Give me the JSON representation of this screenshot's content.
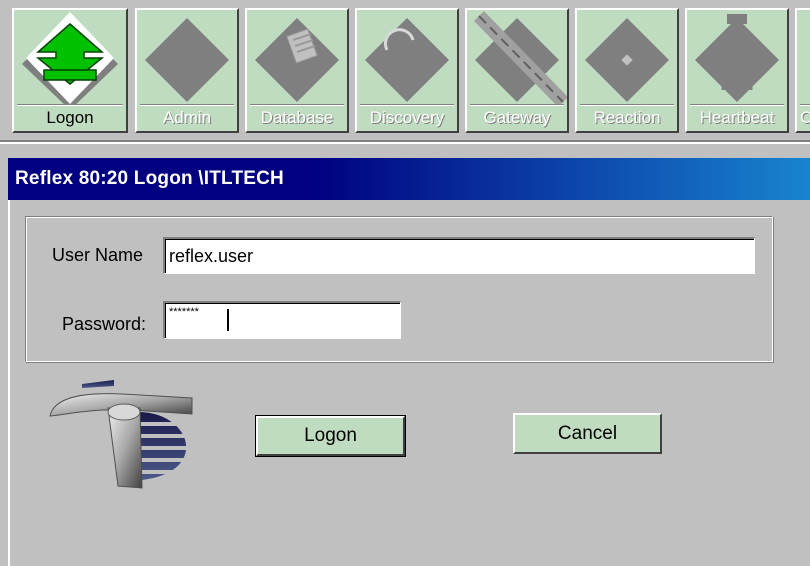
{
  "toolbar": {
    "buttons": [
      {
        "label": "Logon",
        "icon": "logon-arrow-icon"
      },
      {
        "label": "Admin",
        "icon": "admin-diamond-icon"
      },
      {
        "label": "Database",
        "icon": "database-icon"
      },
      {
        "label": "Discovery",
        "icon": "discovery-icon"
      },
      {
        "label": "Gateway",
        "icon": "gateway-icon"
      },
      {
        "label": "Reaction",
        "icon": "reaction-icon"
      },
      {
        "label": "Heartbeat",
        "icon": "heartbeat-icon"
      },
      {
        "label": "C",
        "icon": "more-icon"
      }
    ],
    "active": "Logon"
  },
  "dialog": {
    "title": "Reflex 80:20 Logon \\ITLTECH",
    "username_label": "User Name",
    "username_value": "reflex.user",
    "password_label": "Password:",
    "password_value": "*******",
    "logon_label": "Logon",
    "cancel_label": "Cancel"
  },
  "colors": {
    "title_start": "#000080",
    "title_end": "#1884d0",
    "button_face": "#c0dcc0",
    "window_bg": "#c0c0c0",
    "icon_gray": "#7f7f7f",
    "logon_arrow": "#00c000"
  }
}
